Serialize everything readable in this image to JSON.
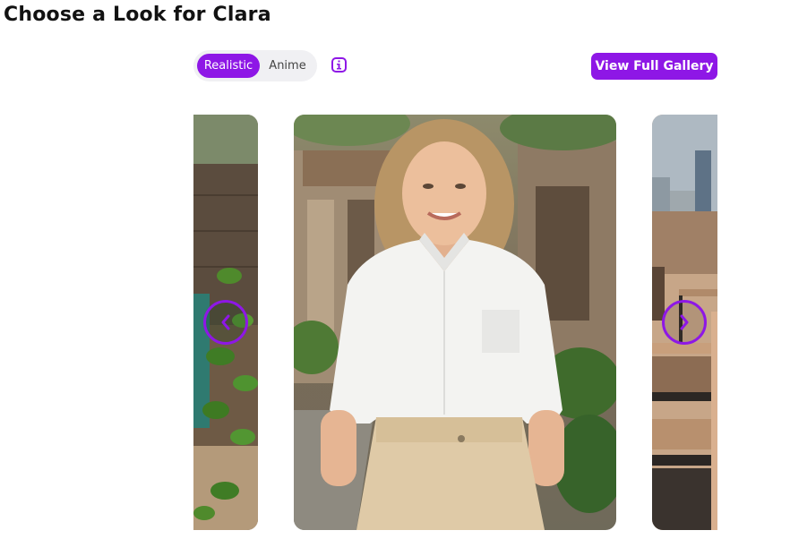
{
  "page": {
    "title": "Choose a Look for Clara"
  },
  "style_toggle": {
    "options": [
      "Realistic",
      "Anime"
    ],
    "selected": "Realistic"
  },
  "info_icon": "info-icon",
  "gallery_button": {
    "label": "View Full Gallery"
  },
  "carousel": {
    "prev_icon": "chevron-left-icon",
    "next_icon": "chevron-right-icon"
  },
  "colors": {
    "accent": "#8e17e6",
    "toggle_bg": "#f0f0f3"
  }
}
